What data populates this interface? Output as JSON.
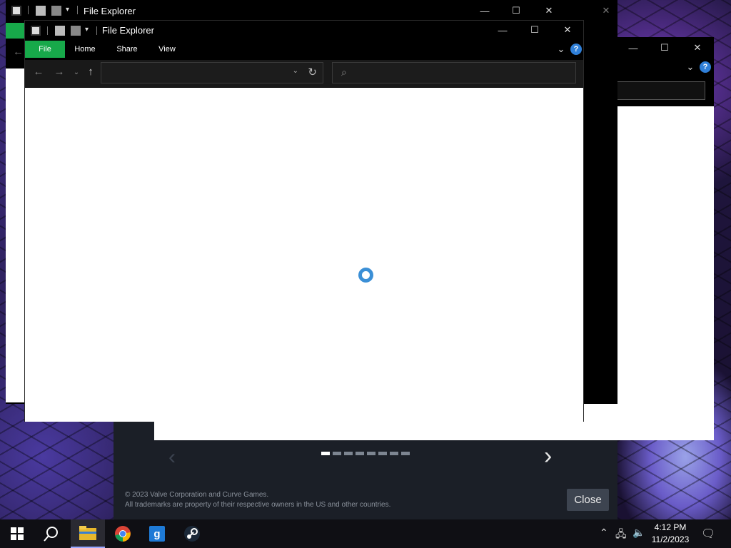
{
  "steam": {
    "copyright_line1": "© 2023 Valve Corporation and Curve Games.",
    "copyright_line2": "All trademarks are property of their respective owners in the US and other countries.",
    "close_label": "Close",
    "prev_arrow": "‹",
    "next_arrow": "›"
  },
  "back_window": {
    "title": "File Explorer",
    "minimize": "—",
    "maximize": "☐",
    "close": "✕"
  },
  "front_window": {
    "title": "File Explorer",
    "minimize": "—",
    "maximize": "☐",
    "close": "✕",
    "tabs": [
      "File",
      "Home",
      "Share",
      "View"
    ],
    "help": "?",
    "expand_ribbon": "⌄",
    "nav": {
      "back": "←",
      "forward": "→",
      "recent": "⌄",
      "up": "↑"
    },
    "address": {
      "value": "",
      "dropdown": "⌄",
      "refresh": "↻"
    },
    "search": {
      "icon": "⌕",
      "placeholder": ""
    },
    "content_state": "loading"
  },
  "taskbar": {
    "apps": [
      "start-icon",
      "search-icon",
      "file-explorer-icon",
      "chrome-icon",
      "g-app-icon",
      "steam-icon"
    ],
    "active_app": "file-explorer-icon",
    "time": "4:12 PM",
    "date": "11/2/2023"
  },
  "colors": {
    "accent_green": "#17a94a",
    "spinner_blue": "#3b8fd6",
    "help_blue": "#2f7fd8"
  }
}
